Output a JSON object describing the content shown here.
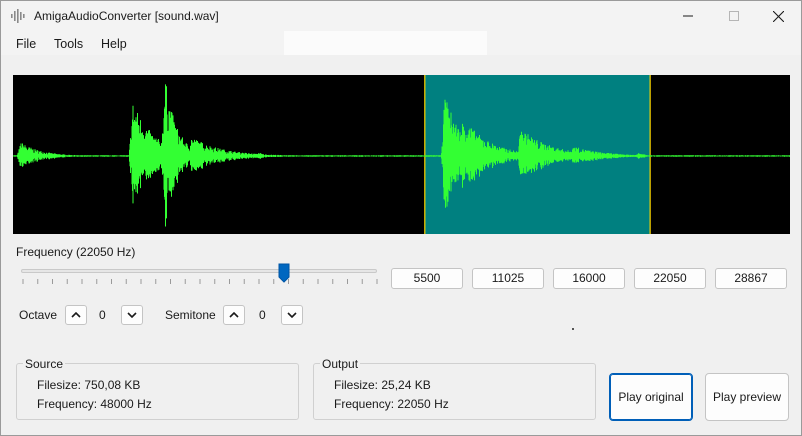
{
  "window": {
    "title": "AmigaAudioConverter [sound.wav]",
    "icon": "waveform-app-icon",
    "controls": [
      "minimize-icon",
      "maximize-icon",
      "close-icon"
    ]
  },
  "menu": {
    "items": [
      "File",
      "Tools",
      "Help"
    ]
  },
  "waveform": {
    "background": "#000000",
    "wave_color": "#33ff33",
    "selection_color": "#008080",
    "selection_edge_color": "#ffd700",
    "selection_range": [
      0.53,
      0.82
    ]
  },
  "frequency": {
    "label": "Frequency (22050 Hz)",
    "slider_value": 22050,
    "slider_fraction": 0.74,
    "presets": [
      "5500",
      "11025",
      "16000",
      "22050",
      "28867"
    ]
  },
  "octave": {
    "label": "Octave",
    "value": "0"
  },
  "semitone": {
    "label": "Semitone",
    "value": "0"
  },
  "source": {
    "title": "Source",
    "filesize": "Filesize: 750,08 KB",
    "frequency": "Frequency: 48000 Hz"
  },
  "output": {
    "title": "Output",
    "filesize": "Filesize: 25,24 KB",
    "frequency": "Frequency: 22050 Hz"
  },
  "buttons": {
    "play_original": "Play original",
    "play_preview": "Play preview"
  },
  "colors": {
    "accent": "#005fb8",
    "slider_thumb": "#0067c0"
  }
}
